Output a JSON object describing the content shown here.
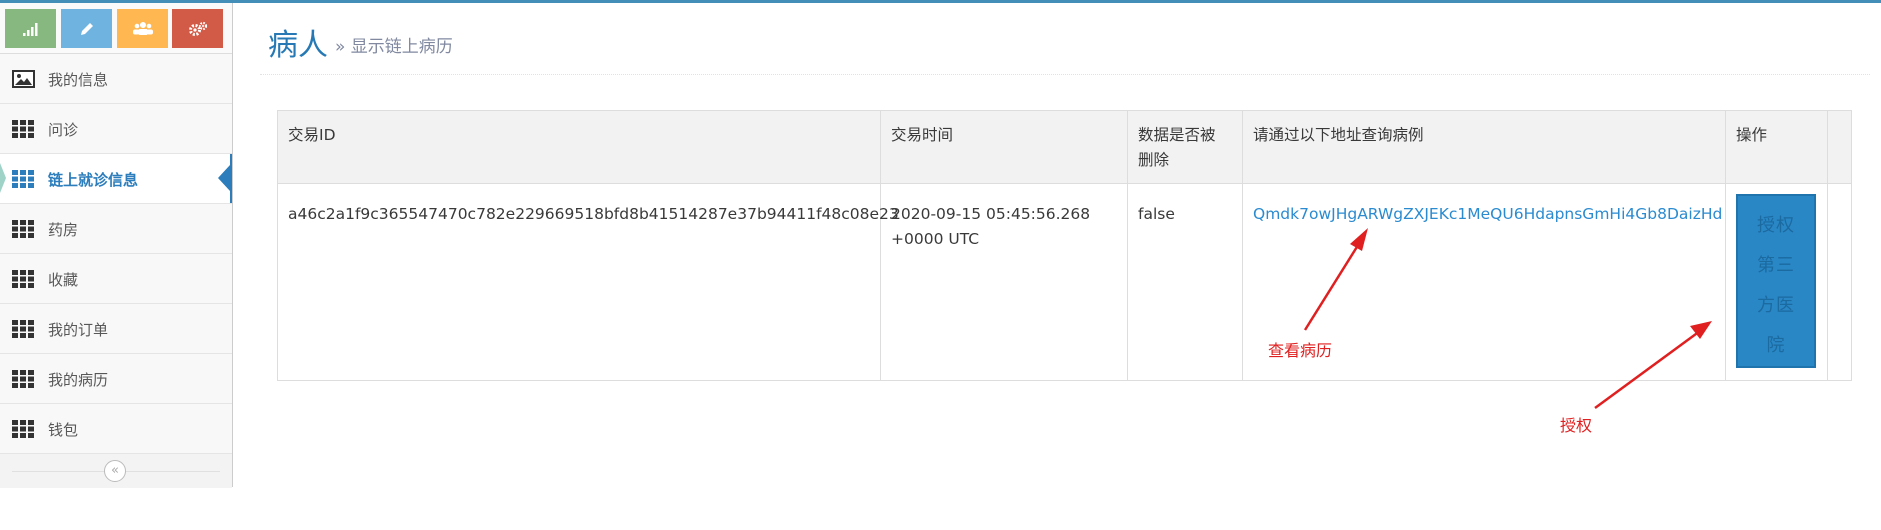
{
  "sidebar": {
    "shortcuts": [
      {
        "name": "signal-icon",
        "color": "#87b87f"
      },
      {
        "name": "pencil-icon",
        "color": "#6fb3e0"
      },
      {
        "name": "users-icon",
        "color": "#ffb752"
      },
      {
        "name": "cogs-icon",
        "color": "#d15b47"
      }
    ],
    "items": [
      {
        "label": "我的信息",
        "icon": "picture-icon"
      },
      {
        "label": "问诊",
        "icon": "grid-icon"
      },
      {
        "label": "链上就诊信息",
        "icon": "grid-icon",
        "active": true
      },
      {
        "label": "药房",
        "icon": "grid-icon"
      },
      {
        "label": "收藏",
        "icon": "grid-icon"
      },
      {
        "label": "我的订单",
        "icon": "grid-icon"
      },
      {
        "label": "我的病历",
        "icon": "grid-icon"
      },
      {
        "label": "钱包",
        "icon": "grid-icon"
      }
    ],
    "collapse_glyph": "«",
    "accent": "#2b7dbc"
  },
  "header": {
    "title": "病人",
    "subtitle": "» 显示链上病历"
  },
  "table": {
    "headers": [
      "交易ID",
      "交易时间",
      "数据是否被删除",
      "请通过以下地址查询病例",
      "操作"
    ],
    "header_lines": {
      "col3_line1": "数据是否被",
      "col3_line2": "删除"
    },
    "rows": [
      {
        "tx_id": "a46c2a1f9c365547470c782e229669518bfd8b41514287e37b94411f48c08e23",
        "time_line1": "2020-09-15 05:45:56.268",
        "time_line2": "+0000 UTC",
        "deleted": "false",
        "address": "Qmdk7owJHgARWgZXJEKc1MeQU6HdapnsGmHi4Gb8DaizHd",
        "action_lines": [
          "授权",
          "第三",
          "方医",
          "院"
        ]
      }
    ]
  },
  "annotations": {
    "view_record": "查看病历",
    "authorize": "授权",
    "color": "#e02020"
  }
}
